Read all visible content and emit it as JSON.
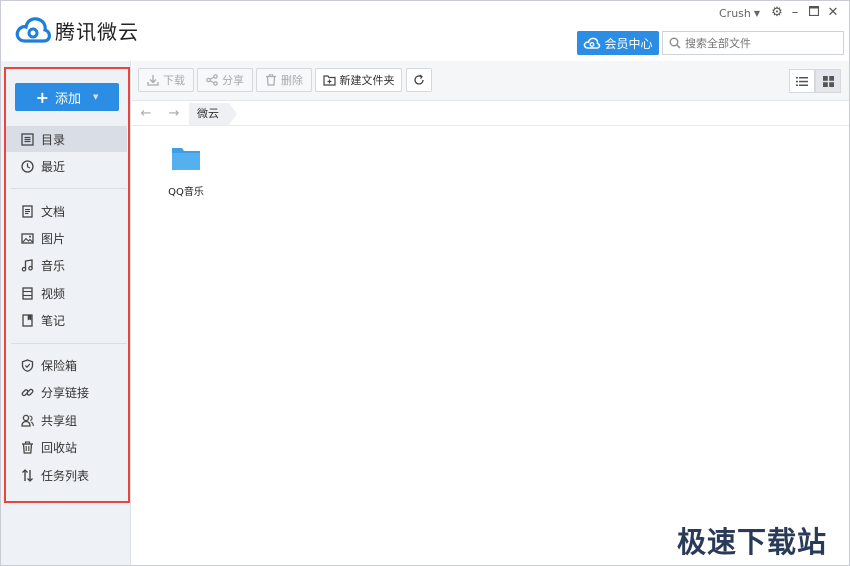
{
  "app": {
    "title": "腾讯微云"
  },
  "header": {
    "username": "Crush",
    "vip_label": "会员中心",
    "search_placeholder": "搜索全部文件"
  },
  "sidebar": {
    "add_label": "添加",
    "items": [
      {
        "label": "目录",
        "icon": "list-icon",
        "active": true
      },
      {
        "label": "最近",
        "icon": "clock-icon"
      },
      {
        "label": "文档",
        "icon": "document-icon"
      },
      {
        "label": "图片",
        "icon": "image-icon"
      },
      {
        "label": "音乐",
        "icon": "music-icon"
      },
      {
        "label": "视频",
        "icon": "video-icon"
      },
      {
        "label": "笔记",
        "icon": "note-icon"
      },
      {
        "label": "保险箱",
        "icon": "shield-icon"
      },
      {
        "label": "分享链接",
        "icon": "link-icon"
      },
      {
        "label": "共享组",
        "icon": "group-icon"
      },
      {
        "label": "回收站",
        "icon": "trash-icon"
      },
      {
        "label": "任务列表",
        "icon": "transfer-icon"
      }
    ]
  },
  "toolbar": {
    "download_label": "下载",
    "share_label": "分享",
    "delete_label": "删除",
    "new_folder_label": "新建文件夹"
  },
  "breadcrumb": {
    "current": "微云"
  },
  "files": [
    {
      "name": "QQ音乐",
      "type": "folder"
    }
  ],
  "watermark": "极速下载站",
  "colors": {
    "accent": "#2b8de4",
    "highlight_border": "#e8453c",
    "folder": "#4aa8ea"
  }
}
